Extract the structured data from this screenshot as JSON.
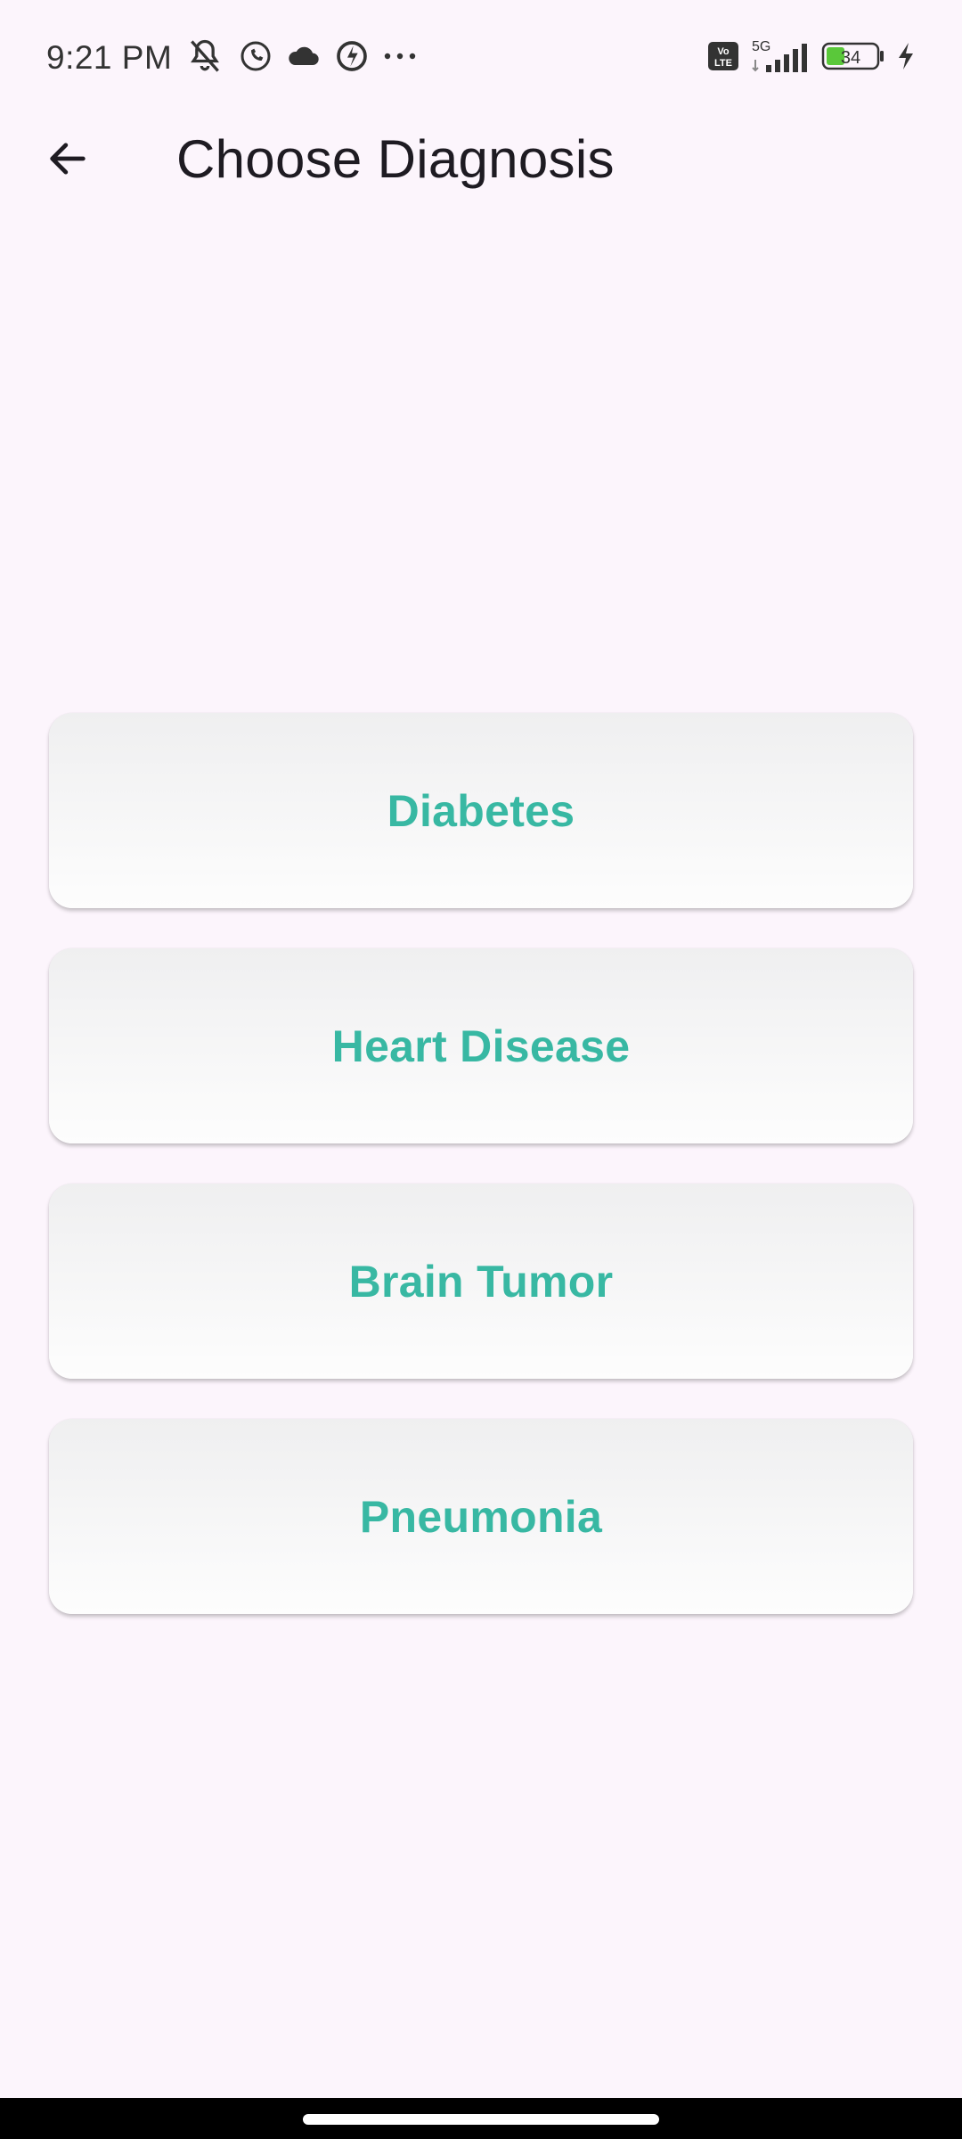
{
  "status_bar": {
    "time": "9:21 PM",
    "network_type": "5G",
    "battery_level": "34",
    "icons": [
      "mute-icon",
      "whatsapp-icon",
      "cloud-icon",
      "sync-app-icon",
      "more-dots-icon",
      "volte-icon",
      "signal-icon",
      "battery-icon",
      "charging-icon"
    ]
  },
  "app_bar": {
    "title": "Choose Diagnosis",
    "back_icon": "back-arrow-icon"
  },
  "diagnoses": [
    {
      "label": "Diabetes"
    },
    {
      "label": "Heart Disease"
    },
    {
      "label": "Brain Tumor"
    },
    {
      "label": "Pneumonia"
    }
  ],
  "colors": {
    "background": "#fcf5fc",
    "accent": "#38b8a3",
    "title": "#1e1b22"
  }
}
